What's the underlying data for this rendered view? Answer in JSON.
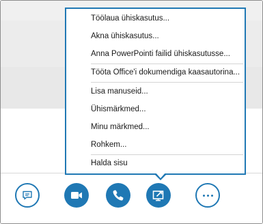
{
  "menu": {
    "items": [
      {
        "label": "Töölaua ühiskasutus..."
      },
      {
        "label": "Akna ühiskasutus..."
      },
      {
        "label": "Anna PowerPointi failid ühiskasutusse..."
      },
      {
        "label": "Tööta Office'i dokumendiga kaasautorina..."
      },
      {
        "label": "Lisa manuseid..."
      },
      {
        "label": "Ühismärkmed..."
      },
      {
        "label": "Minu märkmed..."
      },
      {
        "label": "Rohkem..."
      },
      {
        "label": "Halda sisu"
      }
    ]
  },
  "toolbar": {
    "buttons": [
      {
        "icon": "chat-icon"
      },
      {
        "icon": "video-camera-icon"
      },
      {
        "icon": "phone-icon"
      },
      {
        "icon": "present-screen-icon"
      },
      {
        "icon": "more-icon"
      }
    ]
  },
  "colors": {
    "accent": "#1f78b4",
    "menu_border": "#1f78b4",
    "separator": "#d4d4d4"
  }
}
